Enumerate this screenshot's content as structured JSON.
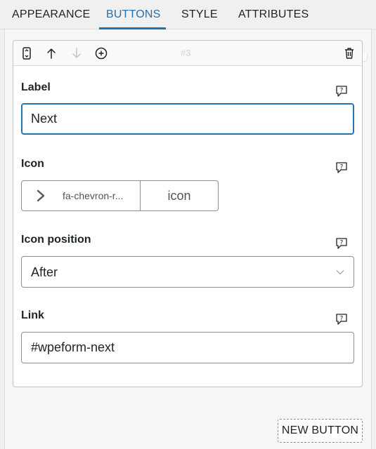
{
  "tabs": [
    {
      "label": "APPEARANCE",
      "active": false
    },
    {
      "label": "BUTTONS",
      "active": true
    },
    {
      "label": "STYLE",
      "active": false
    },
    {
      "label": "ATTRIBUTES",
      "active": false
    }
  ],
  "card": {
    "index": "#3",
    "toolbar_icons": [
      "drag-icon",
      "move-up-icon",
      "move-down-icon",
      "add-icon",
      "trash-icon"
    ],
    "fields": {
      "label": {
        "title": "Label",
        "value": "Next"
      },
      "icon": {
        "title": "Icon",
        "value": "fa-chevron-r...",
        "button_label": "icon"
      },
      "icon_position": {
        "title": "Icon position",
        "value": "After"
      },
      "link": {
        "title": "Link",
        "value": "#wpeform-next"
      }
    }
  },
  "new_button_label": "NEW BUTTON",
  "colors": {
    "accent": "#2271b1",
    "border": "#8c8f94",
    "panel_bg": "#f6f7f7"
  }
}
